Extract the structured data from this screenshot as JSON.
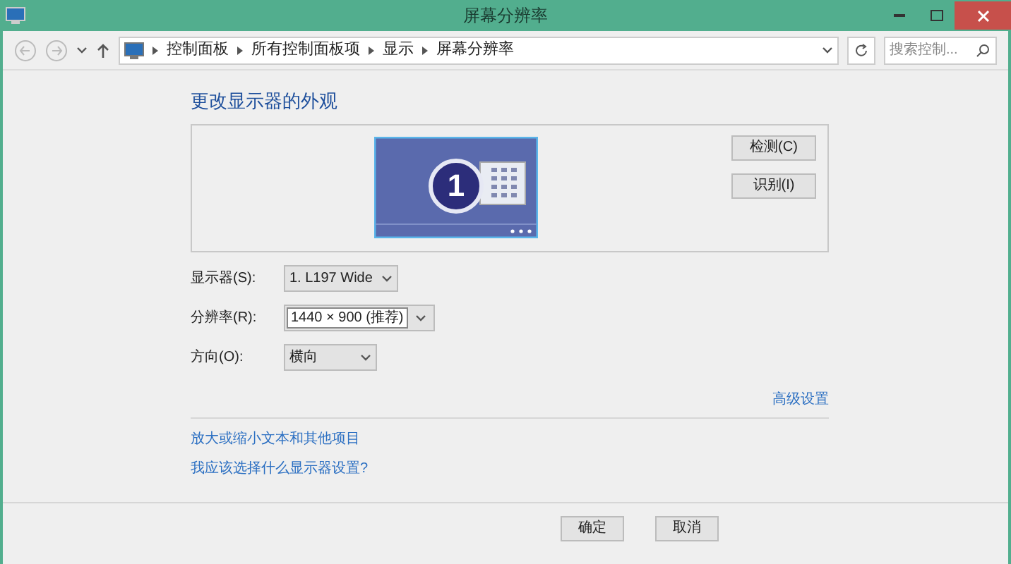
{
  "window": {
    "title": "屏幕分辨率"
  },
  "breadcrumb": [
    "控制面板",
    "所有控制面板项",
    "显示",
    "屏幕分辨率"
  ],
  "search": {
    "placeholder": "搜索控制..."
  },
  "heading": "更改显示器的外观",
  "monitor": {
    "number": "1"
  },
  "side_buttons": [
    "检测(C)",
    "识别(I)"
  ],
  "fields": [
    {
      "label": "显示器(S):",
      "value": "1. L197 Wide",
      "kind": "dropdown"
    },
    {
      "label": "分辨率(R):",
      "value": "1440 × 900 (推荐)",
      "kind": "split"
    },
    {
      "label": "方向(O):",
      "value": "横向",
      "kind": "dropdown"
    }
  ],
  "advanced_link": "高级设置",
  "links": [
    "放大或缩小文本和其他项目",
    "我应该选择什么显示器设置?"
  ],
  "buttons": [
    "确定",
    "取消"
  ]
}
